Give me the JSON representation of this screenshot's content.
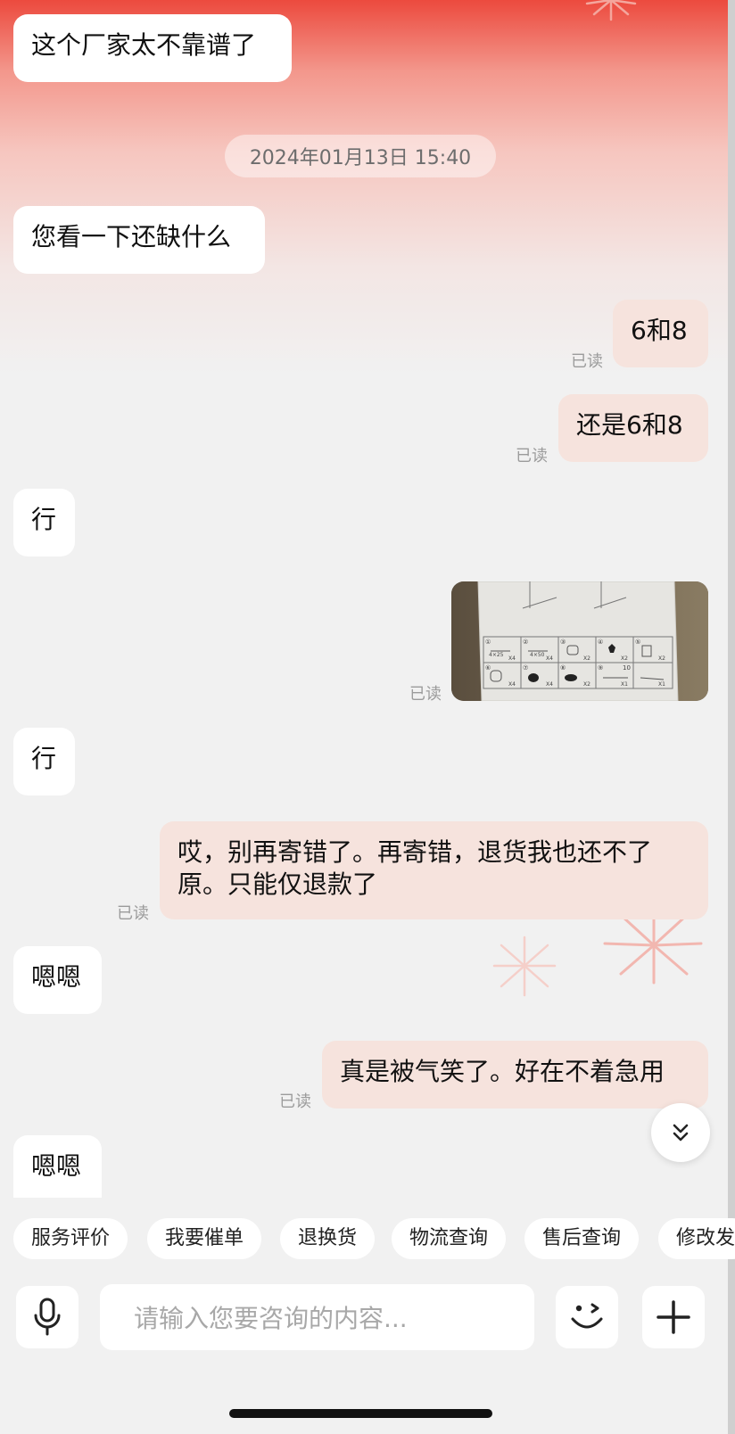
{
  "messages": [
    {
      "text": "这个厂家太不靠谱了"
    },
    {
      "text": "您看一下还缺什么"
    },
    {
      "text": "6和8",
      "status": "已读"
    },
    {
      "text": "还是6和8",
      "status": "已读"
    },
    {
      "text": "行"
    },
    {
      "status": "已读"
    },
    {
      "text": "行"
    },
    {
      "line1": "哎，别再寄错了。再寄错，退货我也还不了",
      "line2": "原。只能仅退款了",
      "status": "已读"
    },
    {
      "text": "嗯嗯"
    },
    {
      "text": "真是被气笑了。好在不着急用",
      "status": "已读"
    },
    {
      "text": "嗯嗯"
    }
  ],
  "timestamp": "2024年01月13日 15:40",
  "image_labels": {
    "n1": "①",
    "n2": "②",
    "n3": "③",
    "n4": "④",
    "n5": "⑤",
    "n6": "⑥",
    "n7": "⑦",
    "n8": "⑧",
    "n9": "⑨",
    "n10": "10",
    "s1": "4×25",
    "s2": "4×50",
    "x4a": "X4",
    "x4b": "X4",
    "x2a": "X2",
    "x2b": "X2",
    "x2c": "X2",
    "x4c": "X4",
    "x4d": "X4",
    "x2d": "X2",
    "x1a": "X1",
    "x1b": "X1"
  },
  "quick_actions": [
    "服务评价",
    "我要催单",
    "退换货",
    "物流查询",
    "售后查询",
    "修改发"
  ],
  "input": {
    "placeholder": "请输入您要咨询的内容..."
  },
  "icons": {
    "mic": "microphone-icon",
    "emoji": "emoji-icon",
    "plus": "plus-icon",
    "scroll": "double-chevron-down-icon"
  },
  "colors": {
    "header_red": "#ec4a3e",
    "outgoing_bubble": "#f6e3dd",
    "incoming_bubble": "#ffffff",
    "background": "#f1f1f1"
  }
}
